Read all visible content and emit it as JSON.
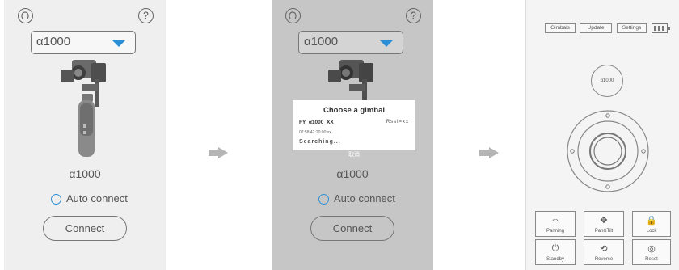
{
  "screen1": {
    "model_select": "α1000",
    "model_label": "α1000",
    "auto_connect": "Auto connect",
    "connect": "Connect",
    "help": "?"
  },
  "screen2": {
    "model_select": "α1000",
    "model_label": "α1000",
    "auto_connect": "Auto connect",
    "connect": "Connect",
    "help": "?",
    "dialog": {
      "title": "Choose a gimbal",
      "device": "FY_α1000_XX",
      "rssi": "Rssi=xx",
      "mac": "07:58:42:20:00:xx",
      "status": "Searching...",
      "cancel": "取消"
    }
  },
  "screen3": {
    "tabs": [
      "Gimbals",
      "Update",
      "Settings"
    ],
    "model": "α1000",
    "buttons": [
      {
        "label": "Panning",
        "icon": "panning-icon"
      },
      {
        "label": "Pan&Tilt",
        "icon": "pan-tilt-icon"
      },
      {
        "label": "Lock",
        "icon": "lock-icon"
      },
      {
        "label": "Standby",
        "icon": "standby-icon"
      },
      {
        "label": "Reverse",
        "icon": "reverse-icon"
      },
      {
        "label": "Reset",
        "icon": "reset-icon"
      }
    ]
  },
  "colors": {
    "accent": "#2a8fd6",
    "dim_overlay": "#c6c6c6",
    "arrow": "#b5b5b5"
  }
}
